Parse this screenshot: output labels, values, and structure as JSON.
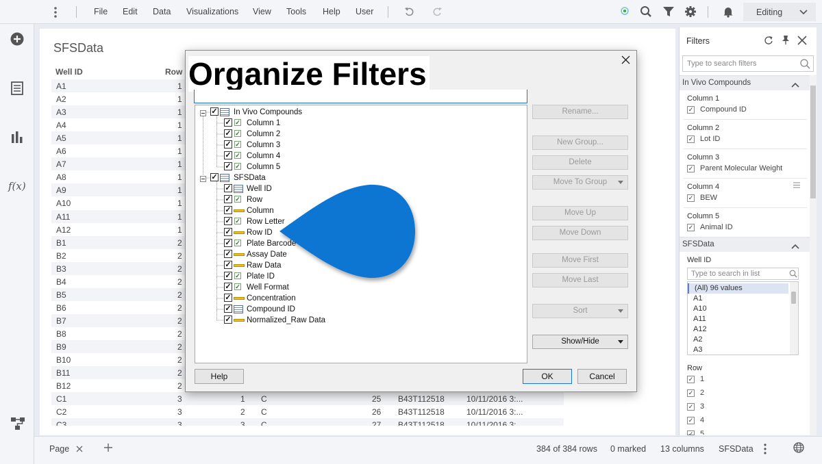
{
  "menubar": {
    "items": [
      "File",
      "Edit",
      "Data",
      "Visualizations",
      "View",
      "Tools",
      "Help",
      "User"
    ],
    "mode": "Editing"
  },
  "page": {
    "title": "SFSData",
    "headers": [
      "Well ID",
      "Row"
    ],
    "rows": [
      [
        "A1",
        "1"
      ],
      [
        "A2",
        "1"
      ],
      [
        "A3",
        "1"
      ],
      [
        "A4",
        "1"
      ],
      [
        "A5",
        "1"
      ],
      [
        "A6",
        "1"
      ],
      [
        "A7",
        "1"
      ],
      [
        "A8",
        "1"
      ],
      [
        "A9",
        "1"
      ],
      [
        "A10",
        "1"
      ],
      [
        "A11",
        "1"
      ],
      [
        "A12",
        "1"
      ],
      [
        "B1",
        "2"
      ],
      [
        "B2",
        "2"
      ],
      [
        "B3",
        "2"
      ],
      [
        "B4",
        "2"
      ],
      [
        "B5",
        "2"
      ],
      [
        "B6",
        "2"
      ],
      [
        "B7",
        "2"
      ],
      [
        "B8",
        "2"
      ],
      [
        "B9",
        "2"
      ],
      [
        "B10",
        "2"
      ],
      [
        "B11",
        "2"
      ],
      [
        "B12",
        "2"
      ]
    ],
    "visible_rows": [
      [
        "C1",
        "3",
        "1",
        "C",
        "25",
        "B43T112518",
        "10/11/2016 3:..."
      ],
      [
        "C2",
        "3",
        "2",
        "C",
        "26",
        "B43T112518",
        "10/11/2016 3:..."
      ],
      [
        "C3",
        "3",
        "3",
        "C",
        "27",
        "B43T112518",
        "10/11/2016 3:"
      ]
    ]
  },
  "status": {
    "page_tab": "Page",
    "rows": "384 of 384 rows",
    "marked": "0 marked",
    "columns": "13 columns",
    "table": "SFSData"
  },
  "filters": {
    "title": "Filters",
    "search_placeholder": "Type to search filters",
    "group1": "In Vivo Compounds",
    "group1_items": [
      {
        "col": "Column 1",
        "label": "Compound ID"
      },
      {
        "col": "Column 2",
        "label": "Lot ID"
      },
      {
        "col": "Column 3",
        "label": "Parent Molecular Weight"
      },
      {
        "col": "Column 4",
        "label": "BEW"
      },
      {
        "col": "Column 5",
        "label": "Animal ID"
      }
    ],
    "group2": "SFSData",
    "well_label": "Well ID",
    "list_placeholder": "Type to search in list",
    "well_values": [
      "(All) 96 values",
      "A1",
      "A10",
      "A11",
      "A12",
      "A2",
      "A3"
    ],
    "row_label": "Row",
    "row_values": [
      "1",
      "2",
      "3",
      "4",
      "5"
    ]
  },
  "dialog": {
    "title": "Organize Filters",
    "tree_groups": [
      "In Vivo Compounds",
      "SFSData"
    ],
    "tree_group1_children": [
      "Column 1",
      "Column 2",
      "Column 3",
      "Column 4",
      "Column 5"
    ],
    "tree_group2_children": [
      "Well ID",
      "Row",
      "Column",
      "Row Letter",
      "Row ID",
      "Plate Barcode",
      "Assay Date",
      "Raw Data",
      "Plate ID",
      "Well Format",
      "Concentration",
      "Compound ID",
      "Normalized_Raw Data"
    ],
    "buttons": {
      "rename": "Rename...",
      "new_group": "New Group...",
      "delete": "Delete",
      "move_to_group": "Move To Group",
      "move_up": "Move Up",
      "move_down": "Move Down",
      "move_first": "Move First",
      "move_last": "Move Last",
      "sort": "Sort",
      "show_hide": "Show/Hide",
      "help": "Help",
      "ok": "OK",
      "cancel": "Cancel"
    }
  },
  "colors": {
    "accent": "#0a78d4",
    "teardrop": "#0a74d2"
  }
}
